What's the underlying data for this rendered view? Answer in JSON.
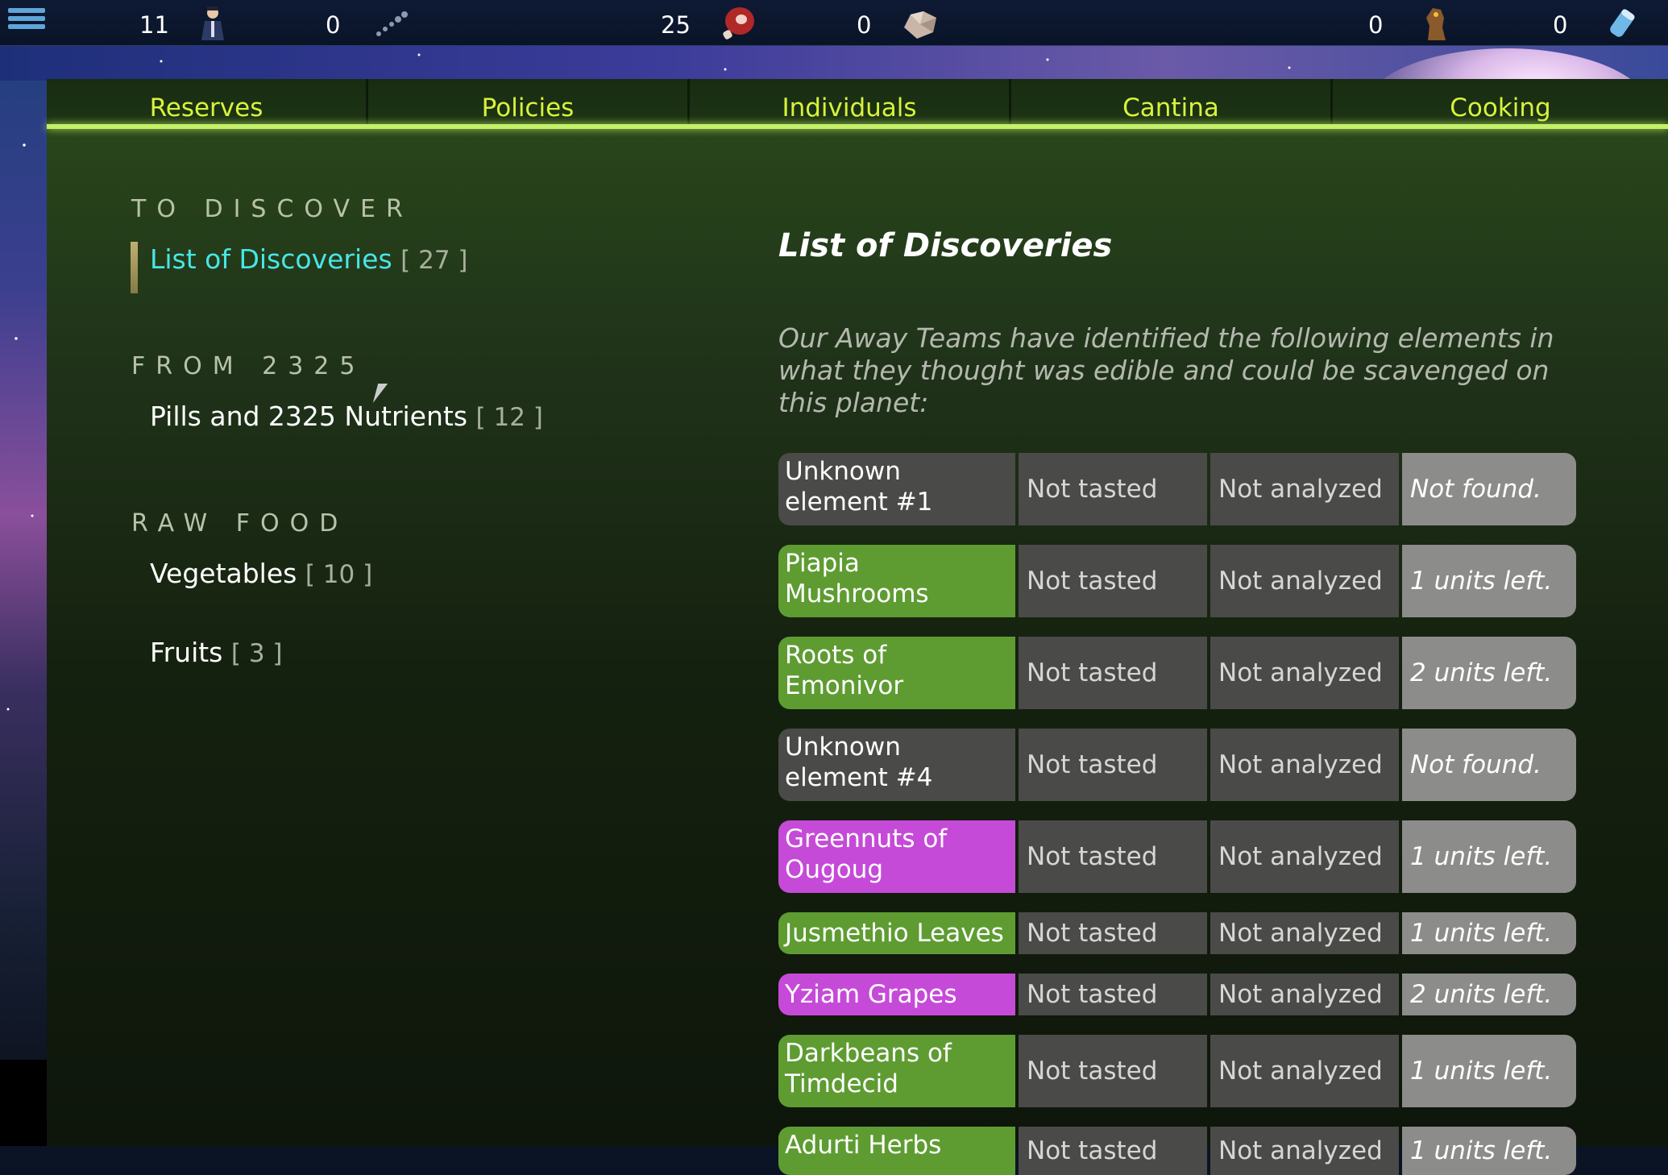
{
  "resources": [
    {
      "value": "11",
      "icon": "crew-member-icon"
    },
    {
      "value": "0",
      "icon": "pill-capsule-icon"
    },
    {
      "value": "25",
      "icon": "meat-icon"
    },
    {
      "value": "0",
      "icon": "rock-food-icon"
    },
    {
      "value": "0",
      "icon": "creature-icon"
    },
    {
      "value": "0",
      "icon": "canister-icon"
    }
  ],
  "tabs": [
    {
      "label": "Reserves"
    },
    {
      "label": "Policies"
    },
    {
      "label": "Individuals"
    },
    {
      "label": "Cantina"
    },
    {
      "label": "Cooking"
    }
  ],
  "sidebar": {
    "sections": [
      {
        "title": "TO DISCOVER",
        "items": [
          {
            "label": "List of Discoveries",
            "count": "[ 27 ]"
          }
        ]
      },
      {
        "title": "FROM 2325",
        "items": [
          {
            "label": "Pills and 2325 Nutrients",
            "count": "[ 12 ]"
          }
        ]
      },
      {
        "title": "RAW FOOD",
        "items": [
          {
            "label": "Vegetables",
            "count": "[ 10 ]"
          },
          {
            "label": "Fruits",
            "count": "[ 3 ]"
          }
        ]
      }
    ]
  },
  "content": {
    "title": "List of Discoveries",
    "intro": "Our Away Teams have identified the following elements in what they thought was edible and could be scavenged on this planet:",
    "rows": [
      {
        "name": "Unknown element #1",
        "taste": "Not tasted",
        "analysis": "Not analyzed",
        "stock": "Not found.",
        "color": "#4a4a48"
      },
      {
        "name": "Piapia Mushrooms",
        "taste": "Not tasted",
        "analysis": "Not analyzed",
        "stock": "1 units left.",
        "color": "#5e9c32"
      },
      {
        "name": "Roots of Emonivor",
        "taste": "Not tasted",
        "analysis": "Not analyzed",
        "stock": "2 units left.",
        "color": "#5e9c32"
      },
      {
        "name": "Unknown element #4",
        "taste": "Not tasted",
        "analysis": "Not analyzed",
        "stock": "Not found.",
        "color": "#4a4a48"
      },
      {
        "name": "Greennuts of Ougoug",
        "taste": "Not tasted",
        "analysis": "Not analyzed",
        "stock": "1 units left.",
        "color": "#c64ad8"
      },
      {
        "name": "Jusmethio Leaves",
        "taste": "Not tasted",
        "analysis": "Not analyzed",
        "stock": "1 units left.",
        "color": "#5e9c32"
      },
      {
        "name": "Yziam Grapes",
        "taste": "Not tasted",
        "analysis": "Not analyzed",
        "stock": "2 units left.",
        "color": "#c64ad8"
      },
      {
        "name": "Darkbeans of Timdecid",
        "taste": "Not tasted",
        "analysis": "Not analyzed",
        "stock": "1 units left.",
        "color": "#5e9c32"
      },
      {
        "name": "Adurti Herbs",
        "taste": "Not tasted",
        "analysis": "Not analyzed",
        "stock": "1 units left.",
        "color": "#5e9c32"
      }
    ]
  }
}
